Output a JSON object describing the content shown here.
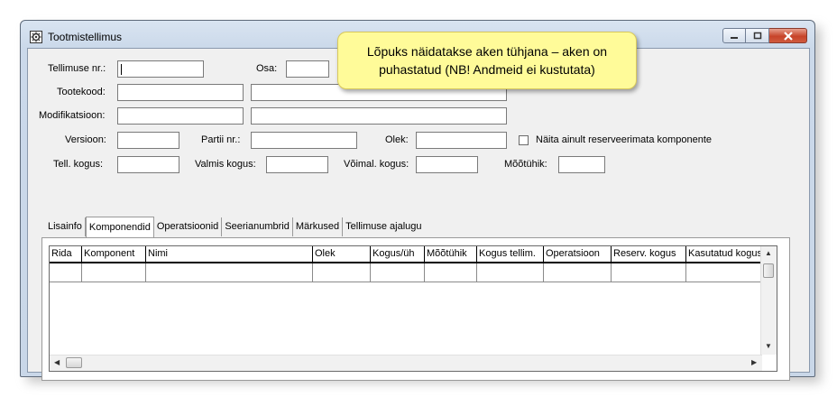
{
  "window": {
    "title": "Tootmistellimus"
  },
  "callout": {
    "line1": "Lõpuks näidatakse aken tühjana – aken on",
    "line2": "puhastatud (NB! Andmeid ei kustutata)"
  },
  "form": {
    "tellimuse_nr_label": "Tellimuse nr.:",
    "osa_label": "Osa:",
    "tootekood_label": "Tootekood:",
    "modifikatsioon_label": "Modifikatsioon:",
    "versioon_label": "Versioon:",
    "partii_label": "Partii nr.:",
    "olek_label": "Olek:",
    "naita_label": "Näita ainult reserveerimata komponente",
    "tell_kogus_label": "Tell. kogus:",
    "valmis_kogus_label": "Valmis kogus:",
    "voimal_kogus_label": "Võimal. kogus:",
    "mootuhik_label": "Mõõtühik:"
  },
  "tabs": [
    "Lisainfo",
    "Komponendid",
    "Operatsioonid",
    "Seerianumbrid",
    "Märkused",
    "Tellimuse ajalugu"
  ],
  "active_tab": "Komponendid",
  "grid": {
    "columns": [
      "Rida",
      "Komponent",
      "Nimi",
      "Olek",
      "Kogus/üh",
      "Mõõtühik",
      "Kogus tellim.",
      "Operatsioon",
      "Reserv. kogus",
      "Kasutatud kogus"
    ]
  },
  "colors": {
    "callout_bg": "#fffb99",
    "client_bg": "#f0f0f0",
    "close_button": "#c7442a"
  }
}
